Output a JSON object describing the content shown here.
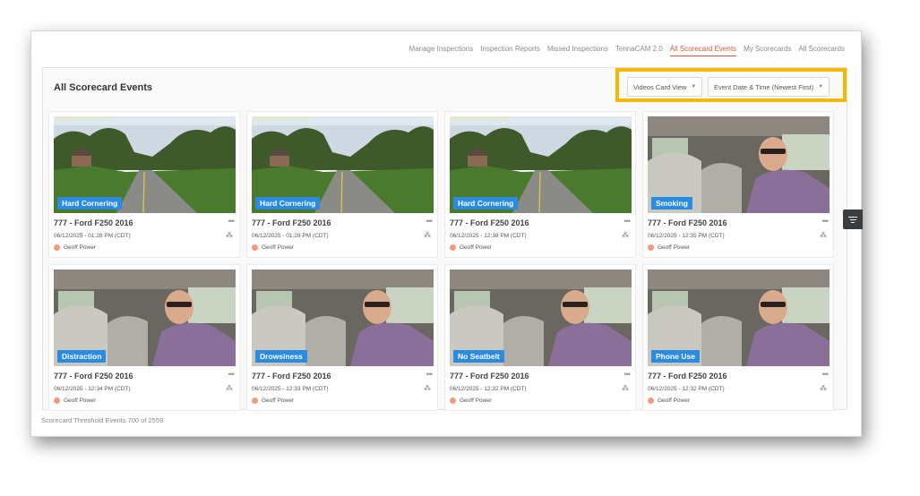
{
  "nav": {
    "items": [
      {
        "label": "Manage Inspections",
        "active": false
      },
      {
        "label": "Inspection Reports",
        "active": false
      },
      {
        "label": "Missed Inspections",
        "active": false
      },
      {
        "label": "TennaCAM 2.0",
        "active": false
      },
      {
        "label": "All Scorecard Events",
        "active": true
      },
      {
        "label": "My Scorecards",
        "active": false
      },
      {
        "label": "All Scorecards",
        "active": false
      }
    ]
  },
  "page": {
    "title": "All Scorecard Events"
  },
  "controls": {
    "view_select": "Videos Card View",
    "sort_select": "Event Date & Time (Newest First)"
  },
  "cards": [
    {
      "event": "Hard Cornering",
      "vehicle": "777 - Ford F250 2016",
      "datetime": "06/12/2025 - 01:28 PM (CDT)",
      "driver": "Geoff Power",
      "overlay": "2025/06/12 13:28:43 CDT",
      "scene": "road"
    },
    {
      "event": "Hard Cornering",
      "vehicle": "777 - Ford F250 2016",
      "datetime": "06/12/2025 - 01:28 PM (CDT)",
      "driver": "Geoff Power",
      "overlay": "2025/06/12 13:28:43 CDT",
      "scene": "road"
    },
    {
      "event": "Hard Cornering",
      "vehicle": "777 - Ford F250 2016",
      "datetime": "06/12/2025 - 12:38 PM (CDT)",
      "driver": "Geoff Power",
      "overlay": "2025/06/12 12:38:09 CDT",
      "scene": "road"
    },
    {
      "event": "Smoking",
      "vehicle": "777 - Ford F250 2016",
      "datetime": "06/12/2025 - 12:35 PM (CDT)",
      "driver": "Geoff Power",
      "overlay": "",
      "scene": "cabin"
    },
    {
      "event": "Distraction",
      "vehicle": "777 - Ford F250 2016",
      "datetime": "06/12/2025 - 12:34 PM (CDT)",
      "driver": "Geoff Power",
      "overlay": "",
      "scene": "cabin"
    },
    {
      "event": "Drowsiness",
      "vehicle": "777 - Ford F250 2016",
      "datetime": "06/12/2025 - 12:33 PM (CDT)",
      "driver": "Geoff Power",
      "overlay": "",
      "scene": "cabin"
    },
    {
      "event": "No Seatbelt",
      "vehicle": "777 - Ford F250 2016",
      "datetime": "06/12/2025 - 12:32 PM (CDT)",
      "driver": "Geoff Power",
      "overlay": "",
      "scene": "cabin"
    },
    {
      "event": "Phone Use",
      "vehicle": "777 - Ford F250 2016",
      "datetime": "06/12/2025 - 12:32 PM (CDT)",
      "driver": "Geoff Power",
      "overlay": "",
      "scene": "cabin"
    }
  ],
  "footer": {
    "count_text": "Scorecard Threshold Events 700 of 2559"
  },
  "colors": {
    "accent": "#d9593d",
    "badge": "#2a8be0",
    "highlight": "#f6b800"
  },
  "icons": {
    "more": "more-dots-icon",
    "share": "share-icon",
    "filter": "filter-icon",
    "chevron": "chevron-down-icon"
  }
}
